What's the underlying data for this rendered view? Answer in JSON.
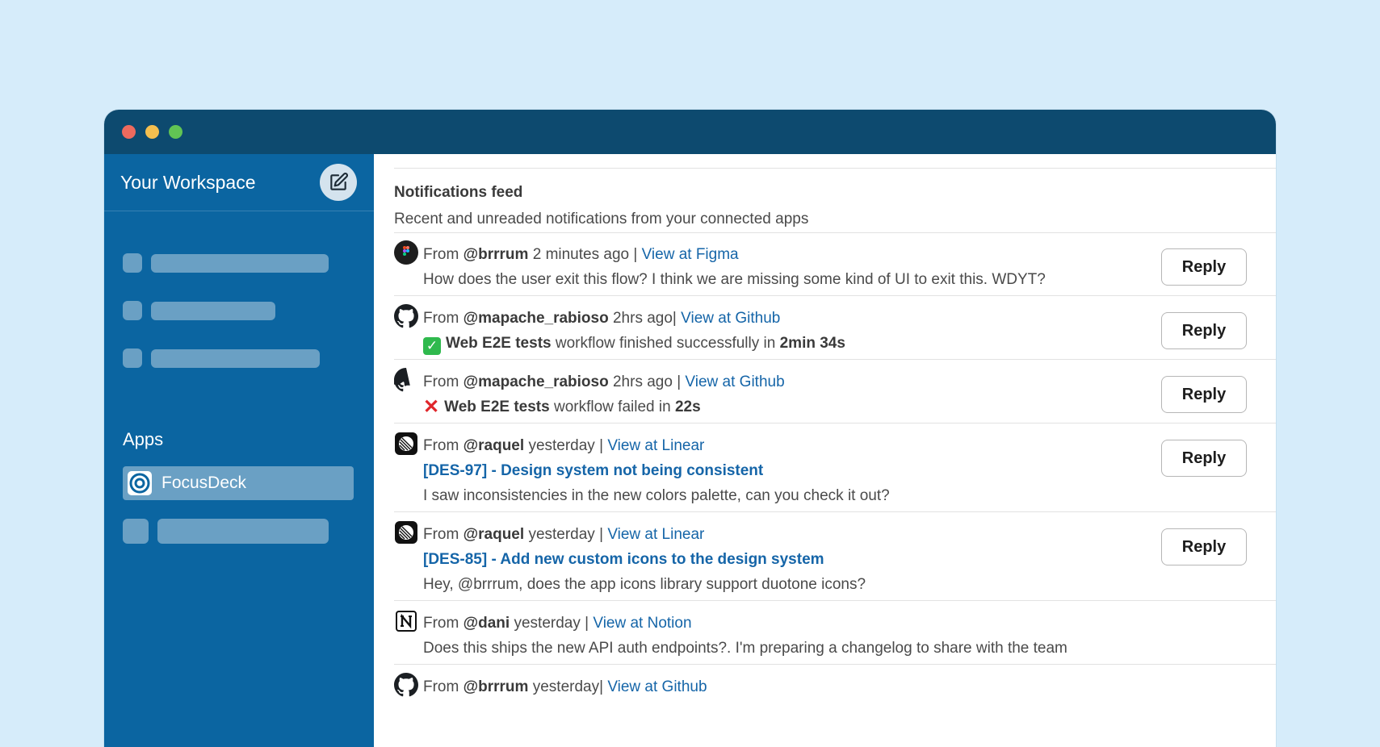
{
  "workspace": {
    "title": "Your Workspace"
  },
  "sidebar": {
    "apps_label": "Apps",
    "active_app": {
      "label": "FocusDeck"
    }
  },
  "feed": {
    "title": "Notifications feed",
    "subtitle": "Recent and unreaded notifications from your connected apps",
    "reply_label": "Reply",
    "items": [
      {
        "app": "figma",
        "from": "From",
        "user": "@brrrum",
        "time": "2 minutes ago |",
        "link": "View at Figma",
        "body": "How does the user exit this flow? I think we are missing some kind of UI to exit this. WDYT?"
      },
      {
        "app": "github",
        "from": "From",
        "user": "@mapache_rabioso",
        "time": "2hrs ago|",
        "link": "View at Github",
        "status": "success",
        "workflow": "Web E2E tests",
        "body_mid": "workflow finished successfully in",
        "duration": "2min 34s"
      },
      {
        "app": "github",
        "from": "From",
        "user": "@mapache_rabioso",
        "time": "2hrs ago |",
        "link": "View at Github",
        "status": "failure",
        "workflow": "Web E2E tests",
        "body_mid": "workflow failed in",
        "duration": "22s"
      },
      {
        "app": "linear",
        "from": "From",
        "user": "@raquel",
        "time": "yesterday |",
        "link": "View at Linear",
        "issue": "[DES-97] - Design system not being consistent",
        "body": "I saw inconsistencies in the new colors palette, can you check it out?"
      },
      {
        "app": "linear",
        "from": "From",
        "user": "@raquel",
        "time": "yesterday |",
        "link": "View at Linear",
        "issue": "[DES-85] - Add new custom icons to the design system",
        "body": "Hey, @brrrum, does the app icons library support duotone icons?"
      },
      {
        "app": "notion",
        "from": "From",
        "user": "@dani",
        "time": "yesterday |",
        "link": "View at Notion",
        "body": "Does this ships the new API auth endpoints?. I'm preparing a changelog to share with the team"
      },
      {
        "app": "github",
        "from": "From",
        "user": "@brrrum",
        "time": "yesterday|",
        "link": "View at Github"
      }
    ]
  },
  "colors": {
    "background": "#d6ecfa",
    "titlebar": "#0d4a6f",
    "sidebar": "#0b65a1",
    "link": "#1565a8"
  }
}
